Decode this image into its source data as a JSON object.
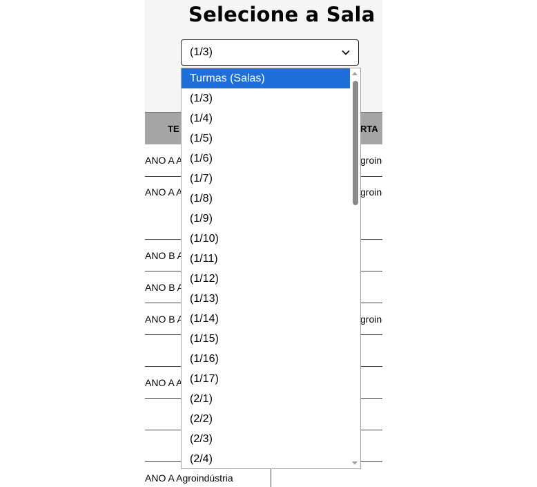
{
  "page": {
    "title": "Selecione a Sala"
  },
  "select": {
    "current_value": "(1/3)"
  },
  "table": {
    "headers": [
      "TE",
      "RTA"
    ],
    "rows": [
      {
        "left": "ANO A A",
        "right": "groinc"
      },
      {
        "left": "ANO A A",
        "right": "groinc"
      },
      {
        "left": "",
        "right": ""
      },
      {
        "left": "ANO B A",
        "right": ""
      },
      {
        "left": "ANO B A",
        "right": ""
      },
      {
        "left": "ANO B A",
        "right": "groinc"
      },
      {
        "left": "",
        "right": ""
      },
      {
        "left": "ANO A A",
        "right": ""
      },
      {
        "left": "",
        "right": ""
      },
      {
        "left": "",
        "right": ""
      },
      {
        "left": "ANO A Agroindústria",
        "right": ""
      }
    ]
  },
  "dropdown": {
    "options": [
      "Turmas (Salas)",
      "(1/3)",
      "(1/4)",
      "(1/5)",
      "(1/6)",
      "(1/7)",
      "(1/8)",
      "(1/9)",
      "(1/10)",
      "(1/11)",
      "(1/12)",
      "(1/13)",
      "(1/14)",
      "(1/15)",
      "(1/16)",
      "(1/17)",
      "(2/1)",
      "(2/2)",
      "(2/3)",
      "(2/4)"
    ],
    "highlighted_index": 0
  },
  "colors": {
    "highlight": "#1e6fd9",
    "table_header": "#a5a5a5"
  },
  "icons": {
    "select_arrow": "chevron-down-icon",
    "scroll_up": "triangle-up-icon",
    "scroll_down": "triangle-down-icon"
  }
}
